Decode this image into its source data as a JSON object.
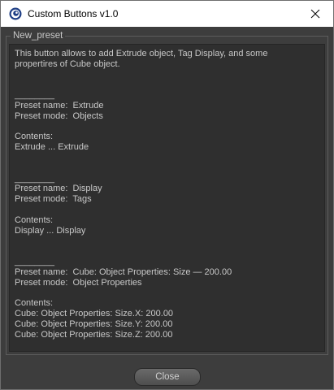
{
  "window": {
    "title": "Custom Buttons v1.0",
    "app_icon": "cinema4d-icon",
    "close_icon": "close-icon"
  },
  "group": {
    "label": "New_preset"
  },
  "description": {
    "lines": [
      "This button allows to add Extrude object, Tag Display, and some",
      "propertires of Cube object.",
      "",
      "",
      "________",
      "Preset name:  Extrude",
      "Preset mode:  Objects",
      "",
      "Contents:",
      "Extrude ... Extrude",
      "",
      "",
      "________",
      "Preset name:  Display",
      "Preset mode:  Tags",
      "",
      "Contents:",
      "Display ... Display",
      "",
      "",
      "________",
      "Preset name:  Cube: Object Properties: Size — 200.00",
      "Preset mode:  Object Properties",
      "",
      "Contents:",
      "Cube: Object Properties: Size.X: 200.00",
      "Cube: Object Properties: Size.Y: 200.00",
      "Cube: Object Properties: Size.Z: 200.00"
    ]
  },
  "footer": {
    "close_label": "Close"
  }
}
